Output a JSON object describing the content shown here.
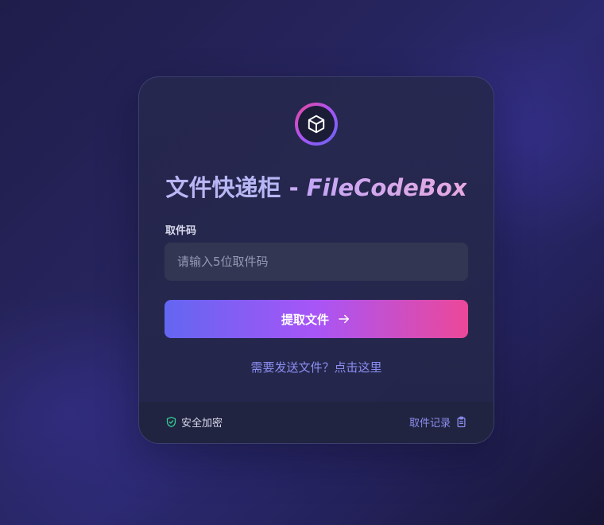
{
  "card": {
    "title_cn": "文件快递柜",
    "title_dash": " - ",
    "title_en": "FileCodeBox",
    "logo_icon": "cube-icon"
  },
  "form": {
    "label": "取件码",
    "placeholder": "请输入5位取件码",
    "value": "",
    "submit_label": "提取文件",
    "submit_icon": "arrow-right-icon"
  },
  "send_link": "需要发送文件？点击这里",
  "footer": {
    "secure_label": "安全加密",
    "secure_icon": "shield-check-icon",
    "history_label": "取件记录",
    "history_icon": "clipboard-icon"
  },
  "colors": {
    "accent_start": "#6366f1",
    "accent_mid": "#a855f7",
    "accent_end": "#ec4899",
    "link": "#8b8ef0",
    "secure_green": "#34d399"
  }
}
